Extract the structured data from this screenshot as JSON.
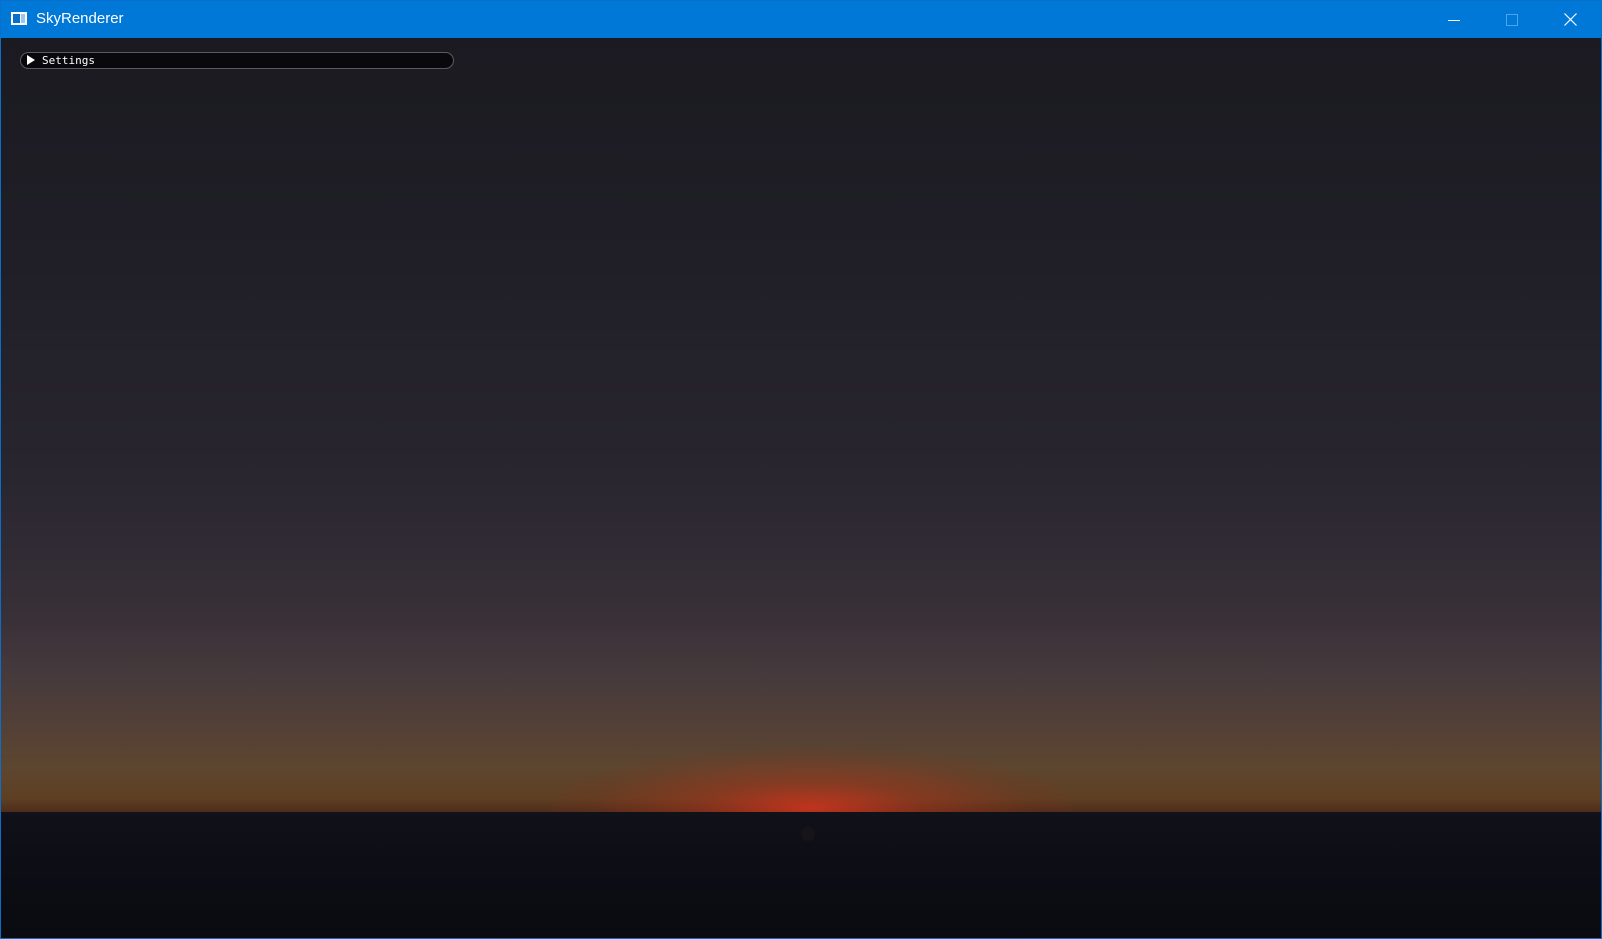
{
  "window": {
    "title": "SkyRenderer",
    "accent_color": "#0078d7",
    "icons": {
      "app": "app-window-icon",
      "minimize": "minimize-icon",
      "maximize": "maximize-icon",
      "close": "close-icon"
    }
  },
  "settings_panel": {
    "label": "Settings",
    "collapsed": true,
    "icon": "collapse-arrow-right-icon"
  },
  "scene": {
    "sky_top_color": "#1b1a21",
    "horizon_glow_color": "#c8341e",
    "ground_color": "#0a0b10"
  }
}
